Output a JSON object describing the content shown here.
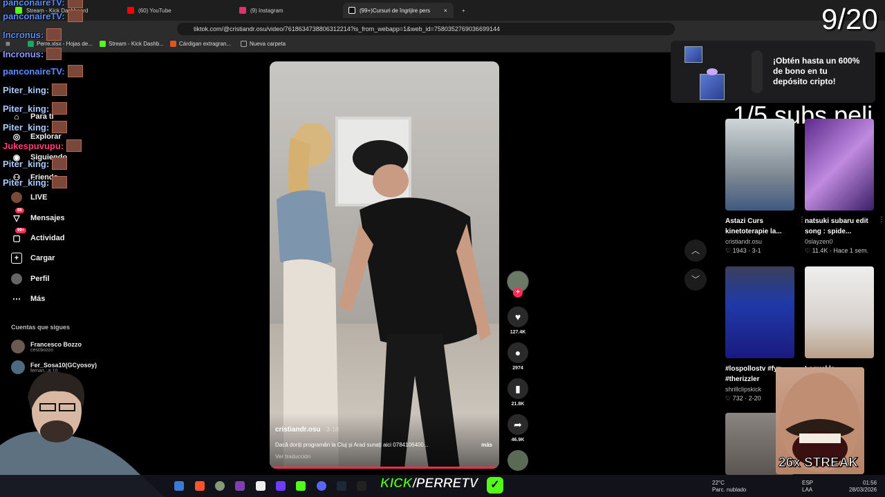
{
  "browser": {
    "tabs": [
      {
        "label": "Stream - Kick Dashboard",
        "color": "#53fc18"
      },
      {
        "label": "(60) YouTube",
        "color": "#ff0000"
      },
      {
        "label": "(9) Instagram",
        "color": "#e1306c"
      },
      {
        "label": "(99+)Cursuri de îngrijire pers",
        "color": "#ffffff"
      }
    ],
    "new_tab": "+",
    "close_tab": "×",
    "url": "tiktok.com/@cristiandr.osu/video/7618634738806312214?is_from_webapp=1&web_id=7580352769036699144",
    "bookmarks": [
      {
        "label": "Perre.xlsx - Hojas de...",
        "color": "#1fa463"
      },
      {
        "label": "Stream - Kick Dashb...",
        "color": "#53fc18"
      },
      {
        "label": "Cárdigan extragran...",
        "color": "#e55225"
      },
      {
        "label": "Nueva carpeta",
        "color": "#aaaaaa"
      }
    ]
  },
  "sidebar": {
    "items": [
      {
        "label": "Para ti",
        "icon": "home-icon"
      },
      {
        "label": "Explorar",
        "icon": "compass-icon"
      },
      {
        "label": "Siguiendo",
        "icon": "following-icon"
      },
      {
        "label": "Friends",
        "icon": "friends-icon"
      },
      {
        "label": "LIVE",
        "icon": "live-icon"
      },
      {
        "label": "Mensajes",
        "icon": "message-icon",
        "badge": "86"
      },
      {
        "label": "Actividad",
        "icon": "activity-icon",
        "badge": "99+"
      },
      {
        "label": "Cargar",
        "icon": "upload-icon"
      },
      {
        "label": "Perfil",
        "icon": "profile-icon"
      },
      {
        "label": "Más",
        "icon": "more-icon"
      }
    ],
    "following_title": "Cuentas que sigues",
    "following": [
      {
        "name": "Francesco Bozzo",
        "handle": "cescbozzo"
      },
      {
        "name": "Fer_Sosa10(GCyosoy)",
        "handle": "fernan...a 10"
      }
    ]
  },
  "chat": [
    {
      "user": "panconaireTV:",
      "color": "#5b8cff"
    },
    {
      "user": "panconaireTV:",
      "color": "#5b8cff"
    },
    {
      "user": "Incronus:",
      "color": "#8a9bff"
    },
    {
      "user": "panconaireTV:",
      "color": "#5b8cff"
    },
    {
      "user": "Piter_king:",
      "color": "#a9c8ff"
    },
    {
      "user": "Piter_king:",
      "color": "#a9c8ff"
    },
    {
      "user": "Piter_king:",
      "color": "#a9c8ff"
    },
    {
      "user": "Jukespuvupu:",
      "color": "#ff3b7a"
    },
    {
      "user": "Piter_king:",
      "color": "#a9c8ff"
    },
    {
      "user": "Piter_king:",
      "color": "#a9c8ff"
    }
  ],
  "video": {
    "author": "cristiandr.osu",
    "date": "· 3-18",
    "description": "Dacă doriți programări la Cluj și Arad sunați aici 0784106400...",
    "more": "más",
    "translate": "Ver traducción",
    "progress_percent": 100
  },
  "actions": {
    "likes": "127.4K",
    "comments": "2974",
    "saves": "21.8K",
    "shares": "46.9K"
  },
  "ad": {
    "text": "¡Obtén hasta un 600% de bono en tu depósito cripto!"
  },
  "overlay": {
    "counter": "9/20",
    "subs": "1/5 subs peli",
    "streak": "26x STREAK",
    "kick_prefix": "KICK",
    "kick_suffix": "/PERRETV"
  },
  "recommendations": [
    {
      "title": "Astazi Curs kinetoterapie la...",
      "author": "cristiandr.osu",
      "meta": "♡ 1943 · 3-1"
    },
    {
      "title": "natsuki subaru edit song : spide...",
      "author": "0slayzen0",
      "meta": "♡ 11.4K · Hace 1 sem."
    },
    {
      "title": "#lospollostv #fyp #therizzler",
      "author": "shrillclipskick",
      "meta": "♡ 732 · 2-20"
    },
    {
      "title": "Laguel la...",
      "author": "",
      "meta": "d"
    }
  ],
  "taskbar": {
    "weather_temp": "22°C",
    "weather_desc": "Parc. nublado",
    "lang_1": "ESP",
    "lang_2": "LAA",
    "time": "01:56",
    "date": "28/03/2026"
  }
}
